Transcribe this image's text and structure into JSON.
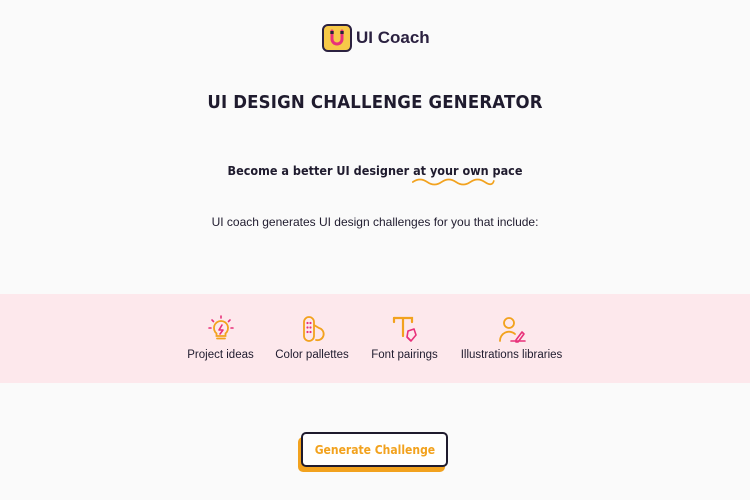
{
  "brand": {
    "name": "UI Coach",
    "logo_icon": "magnet-u-icon",
    "logo_color": "#f7c948"
  },
  "hero": {
    "title": "UI DESIGN CHALLENGE GENERATOR",
    "tagline_prefix": "Become a better UI designer ",
    "tagline_highlight": "at your own pace",
    "subtitle": "UI coach generates UI design challenges for you that include:"
  },
  "features": [
    {
      "icon": "lightbulb-icon",
      "label": "Project ideas"
    },
    {
      "icon": "color-palette-icon",
      "label": "Color pallettes"
    },
    {
      "icon": "font-pen-icon",
      "label": "Font pairings"
    },
    {
      "icon": "illustrator-person-icon",
      "label": "Illustrations libraries"
    }
  ],
  "cta": {
    "label": "Generate Challenge"
  },
  "colors": {
    "accent_orange": "#f2a21e",
    "accent_pink": "#e8317a",
    "band_background": "#fde8ec",
    "text_dark": "#1f1b2e"
  }
}
